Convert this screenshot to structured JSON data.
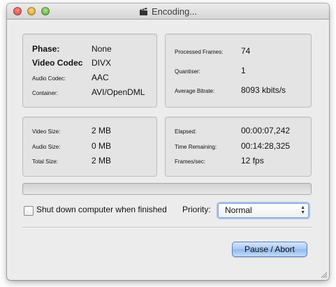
{
  "window": {
    "title": "Encoding...",
    "clapper_icon": "clapperboard-icon"
  },
  "format_panel": {
    "phase_label": "Phase:",
    "phase_value": "None",
    "codec_label": "Video Codec",
    "codec_value": "DIVX",
    "audio_codec_label": "Audio Codec:",
    "audio_codec_value": "AAC",
    "container_label": "Container:",
    "container_value": "AVI/OpenDML"
  },
  "stats_panel": {
    "frames_label": "Processed Frames:",
    "frames_value": "74",
    "quantiser_label": "Quantiser:",
    "quantiser_value": "1",
    "bitrate_label": "Average Bitrate:",
    "bitrate_value": "8093 kbits/s"
  },
  "size_panel": {
    "video_label": "Video Size:",
    "video_value": "2 MB",
    "audio_label": "Audio Size:",
    "audio_value": "0 MB",
    "total_label": "Total Size:",
    "total_value": "2 MB"
  },
  "time_panel": {
    "elapsed_label": "Elapsed:",
    "elapsed_value": "00:00:07,242",
    "remaining_label": "Time Remaining:",
    "remaining_value": "00:14:28,325",
    "fps_label": "Frames/sec:",
    "fps_value": "12 fps"
  },
  "progress": {
    "fraction": 0.0
  },
  "options": {
    "shutdown_label": "Shut down computer when finished",
    "shutdown_checked": false,
    "priority_label": "Priority:",
    "priority_value": "Normal"
  },
  "actions": {
    "pause_label": "Pause / Abort"
  },
  "colors": {
    "accent": "#6aa7e6",
    "button_blue": "#a6c7f2"
  }
}
